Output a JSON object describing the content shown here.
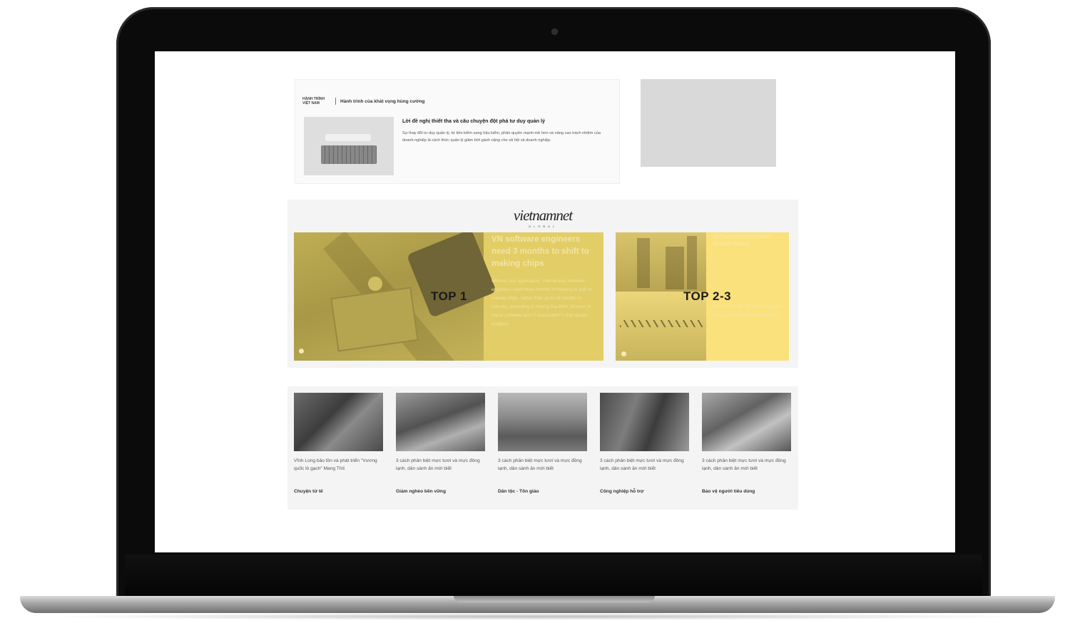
{
  "feature": {
    "logo_text": "HÀNH TRÌNH VIỆT NAM",
    "heading": "Hành trình của khát vọng hùng cường",
    "title": "Lời đề nghị thiết tha và câu chuyện đột phá tư duy quản lý",
    "description": "Sự thay đổi tư duy quản lý, từ tiền kiểm sang hậu kiểm, phân quyền mạnh mẽ hơn và nâng cao trách nhiệm của doanh nghiệp là cách thức quản lý giảm bớt gánh nặng cho xã hội và doanh nghiệp."
  },
  "top_section": {
    "logo": "vietnamnet",
    "logo_sub": "GLOBAL",
    "card1": {
      "label": "TOP 1",
      "title": "VN software engineers need 3 months to shift to making chips",
      "description": "Without new application, Vietnamese software engineers need three months of training to shift to making chips, rather than up to 18 months in schools, according to Hoang Gia Binh, director of Hanoi software and IT Association's chip design program."
    },
    "card2": {
      "label": "TOP 2-3",
      "heading": "VIET NAM BUSINESS NEWS SEARCH VIDEOS",
      "description": "Hanoi to build 10 urban railway lines, reduce traffic congestion"
    }
  },
  "news": [
    {
      "title": "Vĩnh Long bảo tồn và phát triển \"Vương quốc lò gạch\" Mang Thít",
      "category": "Chuyện tử tế"
    },
    {
      "title": "3 cách phân biệt mực tươi và mực đông lạnh, dân sành ăn mới biết",
      "category": "Giảm nghèo bền vững"
    },
    {
      "title": "3 cách phân biệt mực tươi và mực đông lạnh, dân sành ăn mới biết",
      "category": "Dân tộc - Tôn giáo"
    },
    {
      "title": "3 cách phân biệt mực tươi và mực đông lạnh, dân sành ăn mới biết",
      "category": "Công nghiệp hỗ trợ"
    },
    {
      "title": "3 cách phân biệt mực tươi và mực đông lạnh, dân sành ăn mới biết",
      "category": "Bảo vệ người tiêu dùng"
    }
  ]
}
